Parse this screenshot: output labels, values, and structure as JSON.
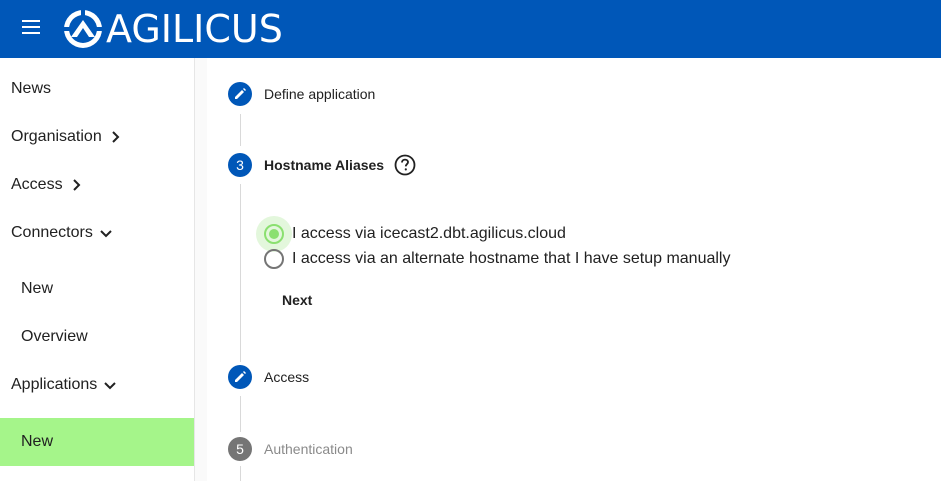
{
  "header": {
    "brand": "AGILICUS",
    "menu_icon": "hamburger-menu-icon",
    "logo_icon": "agilicus-logo-icon",
    "background": "#0057b8"
  },
  "sidebar": {
    "items": [
      {
        "label": "News"
      },
      {
        "label": "Organisation",
        "icon": "chevron-right-icon"
      },
      {
        "label": "Access",
        "icon": "chevron-right-icon"
      },
      {
        "label": "Connectors",
        "icon": "chevron-down-icon"
      },
      {
        "label": "New"
      },
      {
        "label": "Overview"
      },
      {
        "label": "Applications",
        "icon": "chevron-down-icon"
      },
      {
        "label": "New",
        "active": true
      }
    ],
    "active_color": "#a5f58a"
  },
  "stepper": {
    "steps": [
      {
        "label": "Define application",
        "icon": "pencil-icon",
        "state": "edit"
      },
      {
        "number": "3",
        "label": "Hostname Aliases",
        "state": "active",
        "help_icon": "help-circle-icon"
      },
      {
        "label": "Access",
        "icon": "pencil-icon",
        "state": "edit"
      },
      {
        "number": "5",
        "label": "Authentication",
        "state": "pending"
      }
    ],
    "options": [
      {
        "label": "I access via icecast2.dbt.agilicus.cloud",
        "checked": true
      },
      {
        "label": "I access via an alternate hostname that I have setup manually",
        "checked": false
      }
    ],
    "next_label": "Next"
  }
}
